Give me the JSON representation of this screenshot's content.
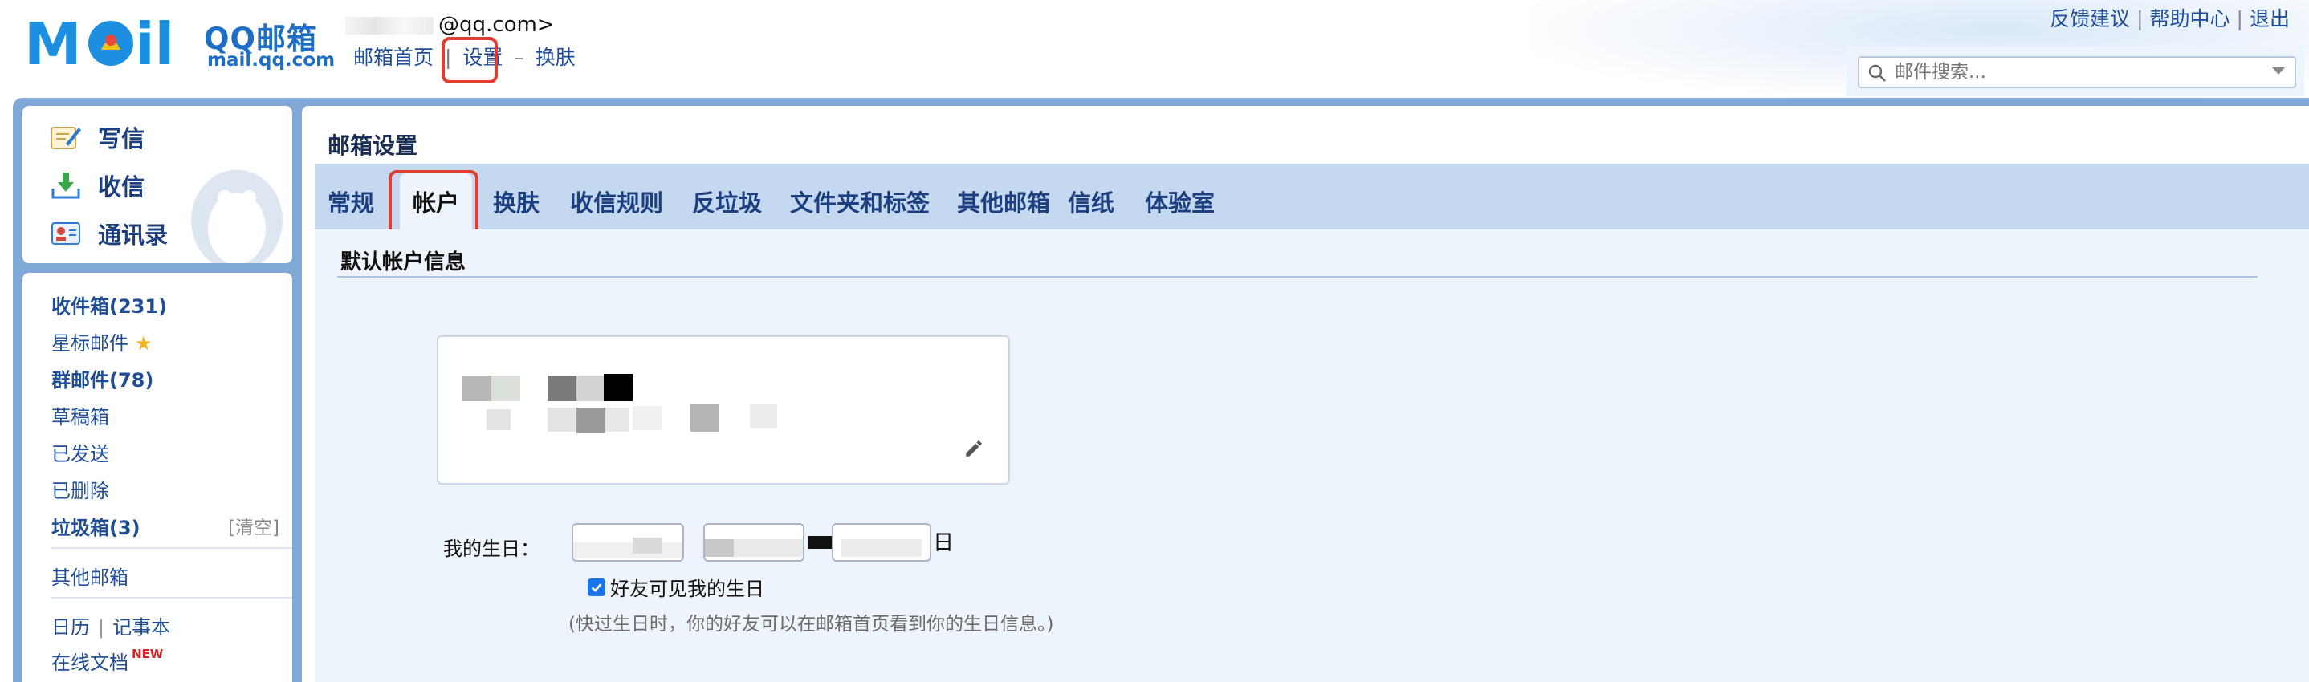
{
  "brand": {
    "name": "QQ邮箱",
    "url": "mail.qq.com"
  },
  "account": {
    "email_suffix": "@qq.com>"
  },
  "top_nav": {
    "home": "邮箱首页",
    "settings": "设置",
    "dash": "–",
    "skin": "换肤",
    "separator": "|"
  },
  "top_right": {
    "feedback": "反馈建议",
    "help": "帮助中心",
    "logout": "退出",
    "separator": "|"
  },
  "search": {
    "placeholder": "邮件搜索..."
  },
  "quick_actions": {
    "compose": "写信",
    "inbox": "收信",
    "contacts": "通讯录"
  },
  "folders": {
    "inbox": "收件箱(231)",
    "starred": "星标邮件",
    "group": "群邮件(78)",
    "drafts": "草稿箱",
    "sent": "已发送",
    "deleted": "已删除",
    "spam": "垃圾箱(3)",
    "clear": "[清空]",
    "other_mailboxes": "其他邮箱",
    "calendar": "日历",
    "notes": "记事本",
    "docs": "在线文档",
    "new_badge": "NEW",
    "separator": "|"
  },
  "settings": {
    "title": "邮箱设置",
    "tabs": [
      "常规",
      "帐户",
      "换肤",
      "收信规则",
      "反垃圾",
      "文件夹和标签",
      "其他邮箱",
      "信纸",
      "体验室"
    ],
    "active_tab_index": 1,
    "section_title": "默认帐户信息",
    "birthday_label": "我的生日：",
    "day_suffix": "日",
    "show_birthday_label": "好友可见我的生日",
    "show_birthday_checked": true,
    "hint": "(快过生日时，你的好友可以在邮箱首页看到你的生日信息。)"
  },
  "colors": {
    "brand_blue": "#1d6ec4",
    "link_blue": "#1e4e9a",
    "frame_blue": "#7fa8d6",
    "tab_bar": "#c4d9f0",
    "content_bg": "#eef4fc",
    "highlight_red": "#e33b2d"
  },
  "icons": {
    "compose": "compose-icon",
    "inbox": "inbox-download-icon",
    "contacts": "contacts-card-icon",
    "search": "search-icon",
    "edit": "pencil-icon",
    "star": "star-icon"
  }
}
